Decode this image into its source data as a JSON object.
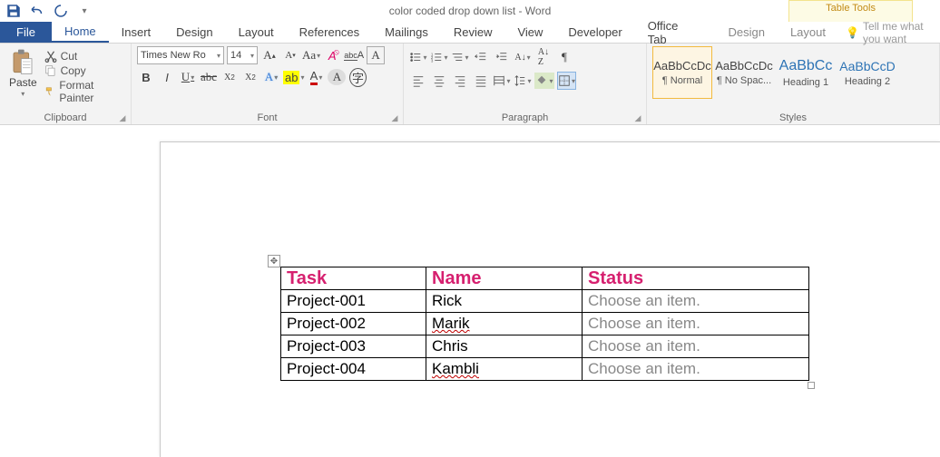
{
  "titlebar": {
    "doc_title": "color coded drop down list - Word",
    "table_tools": "Table Tools"
  },
  "tabs": {
    "file": "File",
    "home": "Home",
    "insert": "Insert",
    "design": "Design",
    "layout": "Layout",
    "references": "References",
    "mailings": "Mailings",
    "review": "Review",
    "view": "View",
    "developer": "Developer",
    "office_tab": "Office Tab",
    "tt_design": "Design",
    "tt_layout": "Layout",
    "tell_me": "Tell me what you want"
  },
  "clipboard": {
    "paste": "Paste",
    "cut": "Cut",
    "copy": "Copy",
    "format_painter": "Format Painter",
    "group": "Clipboard"
  },
  "font": {
    "name": "Times New Ro",
    "size": "14",
    "group": "Font"
  },
  "paragraph": {
    "group": "Paragraph"
  },
  "styles": {
    "group": "Styles",
    "items": [
      {
        "preview": "AaBbCcDc",
        "label": "¶ Normal",
        "color": "#333",
        "size": "13px"
      },
      {
        "preview": "AaBbCcDc",
        "label": "¶ No Spac...",
        "color": "#333",
        "size": "13px"
      },
      {
        "preview": "AaBbCc",
        "label": "Heading 1",
        "color": "#2e74b5",
        "size": "16px"
      },
      {
        "preview": "AaBbCcD",
        "label": "Heading 2",
        "color": "#2e74b5",
        "size": "14px"
      }
    ]
  },
  "table": {
    "headers": {
      "task": "Task",
      "name": "Name",
      "status": "Status"
    },
    "rows": [
      {
        "task": "Project-001",
        "name": "Rick",
        "status": "Choose an item."
      },
      {
        "task": "Project-002",
        "name": "Marik",
        "status": "Choose an item."
      },
      {
        "task": "Project-003",
        "name": "Chris",
        "status": "Choose an item."
      },
      {
        "task": "Project-004",
        "name": "Kambli",
        "status": "Choose an item."
      }
    ]
  }
}
